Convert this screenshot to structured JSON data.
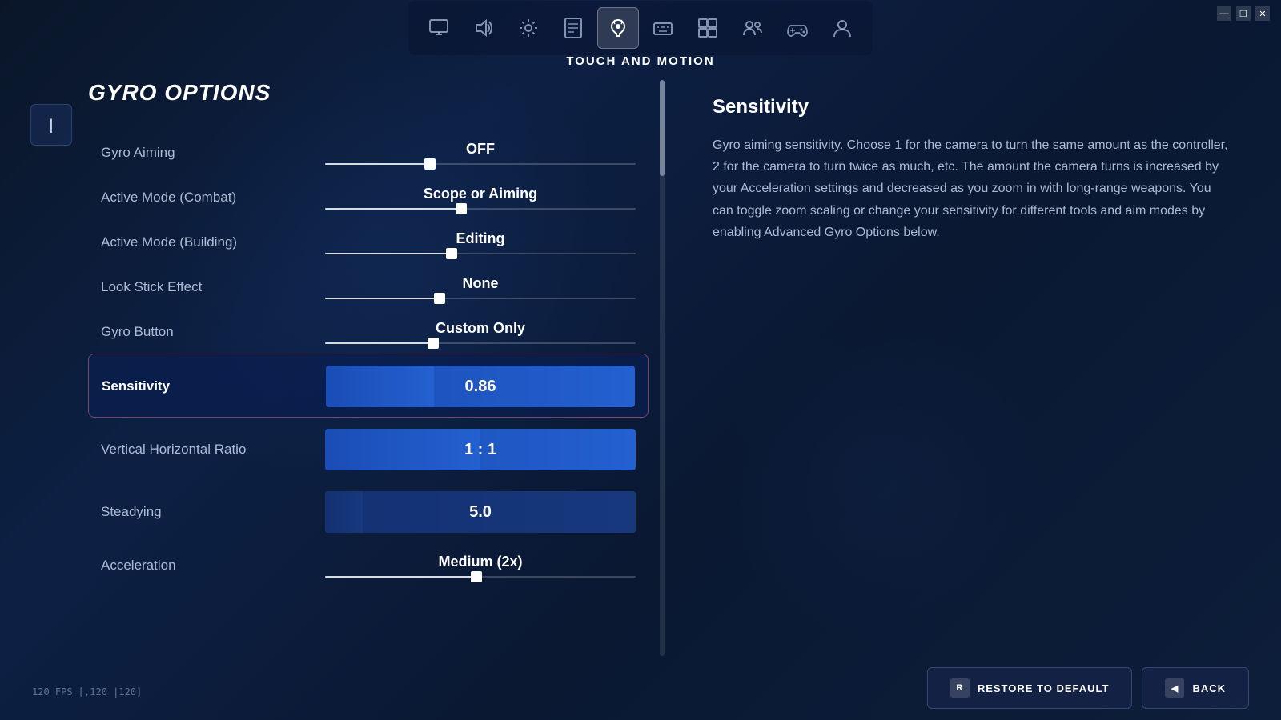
{
  "window": {
    "title": "Settings",
    "controls": {
      "minimize": "—",
      "restore": "❐",
      "close": "✕"
    }
  },
  "nav": {
    "icons": [
      {
        "id": "display",
        "symbol": "🖥",
        "label": "Display",
        "active": false
      },
      {
        "id": "audio",
        "symbol": "🔊",
        "label": "Audio",
        "active": false
      },
      {
        "id": "settings",
        "symbol": "⚙",
        "label": "Settings",
        "active": false
      },
      {
        "id": "input",
        "symbol": "📋",
        "label": "Input",
        "active": false
      },
      {
        "id": "touch-motion",
        "symbol": "✋",
        "label": "Touch and Motion",
        "active": true
      },
      {
        "id": "keyboard",
        "symbol": "⌨",
        "label": "Keyboard",
        "active": false
      },
      {
        "id": "layout",
        "symbol": "⊞",
        "label": "Layout",
        "active": false
      },
      {
        "id": "parties",
        "symbol": "👥",
        "label": "Parties",
        "active": false
      },
      {
        "id": "controller",
        "symbol": "🎮",
        "label": "Controller",
        "active": false
      },
      {
        "id": "account",
        "symbol": "👤",
        "label": "Account",
        "active": false
      }
    ]
  },
  "page_title": "TOUCH AND MOTION",
  "settings": {
    "title": "GYRO OPTIONS",
    "items": [
      {
        "id": "gyro-aiming",
        "label": "Gyro Aiming",
        "value": "OFF",
        "selected": false,
        "type": "slider",
        "slider_pos": 0.35
      },
      {
        "id": "active-mode-combat",
        "label": "Active Mode (Combat)",
        "value": "Scope or Aiming",
        "selected": false,
        "type": "slider",
        "slider_pos": 0.45
      },
      {
        "id": "active-mode-building",
        "label": "Active Mode (Building)",
        "value": "Editing",
        "selected": false,
        "type": "slider",
        "slider_pos": 0.42
      },
      {
        "id": "look-stick-effect",
        "label": "Look Stick Effect",
        "value": "None",
        "selected": false,
        "type": "slider",
        "slider_pos": 0.38
      },
      {
        "id": "gyro-button",
        "label": "Gyro Button",
        "value": "Custom Only",
        "selected": false,
        "type": "slider",
        "slider_pos": 0.36
      },
      {
        "id": "sensitivity",
        "label": "Sensitivity",
        "value": "0.86",
        "selected": true,
        "type": "blue-bar",
        "bar_fill": 0.35
      },
      {
        "id": "vertical-horizontal-ratio",
        "label": "Vertical Horizontal Ratio",
        "value": "1 : 1",
        "selected": false,
        "type": "ratio-bar",
        "bar_fill": 0.5
      },
      {
        "id": "steadying",
        "label": "Steadying",
        "value": "5.0",
        "selected": false,
        "type": "steadying-bar",
        "bar_fill": 0.12
      },
      {
        "id": "acceleration",
        "label": "Acceleration",
        "value": "Medium (2x)",
        "selected": false,
        "type": "acceleration-bar",
        "bar_fill": 0.5
      }
    ]
  },
  "info_panel": {
    "title": "Sensitivity",
    "description": "Gyro aiming sensitivity. Choose 1 for the camera to turn the same amount as the controller, 2 for the camera to turn twice as much, etc. The amount the camera turns is increased by your Acceleration settings and decreased as you zoom in with long-range weapons. You can toggle zoom scaling or change your sensitivity for different tools and aim modes by enabling Advanced Gyro Options below."
  },
  "bottom": {
    "restore_icon": "R",
    "restore_label": "RESTORE TO DEFAULT",
    "back_icon": "◀",
    "back_label": "BACK"
  },
  "fps": "120 FPS [,120 |120]"
}
